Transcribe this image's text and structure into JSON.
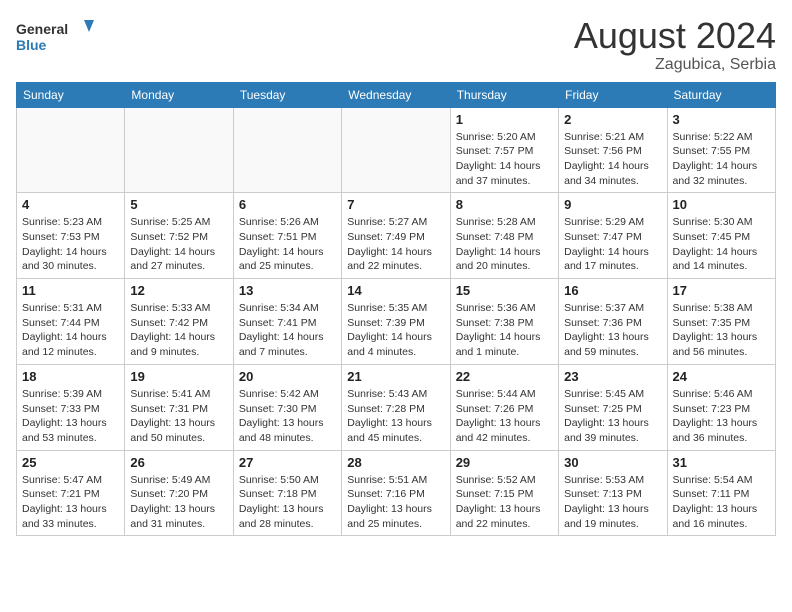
{
  "header": {
    "logo_line1": "General",
    "logo_line2": "Blue",
    "month_year": "August 2024",
    "location": "Zagubica, Serbia"
  },
  "days_of_week": [
    "Sunday",
    "Monday",
    "Tuesday",
    "Wednesday",
    "Thursday",
    "Friday",
    "Saturday"
  ],
  "weeks": [
    [
      {
        "day": "",
        "info": ""
      },
      {
        "day": "",
        "info": ""
      },
      {
        "day": "",
        "info": ""
      },
      {
        "day": "",
        "info": ""
      },
      {
        "day": "1",
        "info": "Sunrise: 5:20 AM\nSunset: 7:57 PM\nDaylight: 14 hours\nand 37 minutes."
      },
      {
        "day": "2",
        "info": "Sunrise: 5:21 AM\nSunset: 7:56 PM\nDaylight: 14 hours\nand 34 minutes."
      },
      {
        "day": "3",
        "info": "Sunrise: 5:22 AM\nSunset: 7:55 PM\nDaylight: 14 hours\nand 32 minutes."
      }
    ],
    [
      {
        "day": "4",
        "info": "Sunrise: 5:23 AM\nSunset: 7:53 PM\nDaylight: 14 hours\nand 30 minutes."
      },
      {
        "day": "5",
        "info": "Sunrise: 5:25 AM\nSunset: 7:52 PM\nDaylight: 14 hours\nand 27 minutes."
      },
      {
        "day": "6",
        "info": "Sunrise: 5:26 AM\nSunset: 7:51 PM\nDaylight: 14 hours\nand 25 minutes."
      },
      {
        "day": "7",
        "info": "Sunrise: 5:27 AM\nSunset: 7:49 PM\nDaylight: 14 hours\nand 22 minutes."
      },
      {
        "day": "8",
        "info": "Sunrise: 5:28 AM\nSunset: 7:48 PM\nDaylight: 14 hours\nand 20 minutes."
      },
      {
        "day": "9",
        "info": "Sunrise: 5:29 AM\nSunset: 7:47 PM\nDaylight: 14 hours\nand 17 minutes."
      },
      {
        "day": "10",
        "info": "Sunrise: 5:30 AM\nSunset: 7:45 PM\nDaylight: 14 hours\nand 14 minutes."
      }
    ],
    [
      {
        "day": "11",
        "info": "Sunrise: 5:31 AM\nSunset: 7:44 PM\nDaylight: 14 hours\nand 12 minutes."
      },
      {
        "day": "12",
        "info": "Sunrise: 5:33 AM\nSunset: 7:42 PM\nDaylight: 14 hours\nand 9 minutes."
      },
      {
        "day": "13",
        "info": "Sunrise: 5:34 AM\nSunset: 7:41 PM\nDaylight: 14 hours\nand 7 minutes."
      },
      {
        "day": "14",
        "info": "Sunrise: 5:35 AM\nSunset: 7:39 PM\nDaylight: 14 hours\nand 4 minutes."
      },
      {
        "day": "15",
        "info": "Sunrise: 5:36 AM\nSunset: 7:38 PM\nDaylight: 14 hours\nand 1 minute."
      },
      {
        "day": "16",
        "info": "Sunrise: 5:37 AM\nSunset: 7:36 PM\nDaylight: 13 hours\nand 59 minutes."
      },
      {
        "day": "17",
        "info": "Sunrise: 5:38 AM\nSunset: 7:35 PM\nDaylight: 13 hours\nand 56 minutes."
      }
    ],
    [
      {
        "day": "18",
        "info": "Sunrise: 5:39 AM\nSunset: 7:33 PM\nDaylight: 13 hours\nand 53 minutes."
      },
      {
        "day": "19",
        "info": "Sunrise: 5:41 AM\nSunset: 7:31 PM\nDaylight: 13 hours\nand 50 minutes."
      },
      {
        "day": "20",
        "info": "Sunrise: 5:42 AM\nSunset: 7:30 PM\nDaylight: 13 hours\nand 48 minutes."
      },
      {
        "day": "21",
        "info": "Sunrise: 5:43 AM\nSunset: 7:28 PM\nDaylight: 13 hours\nand 45 minutes."
      },
      {
        "day": "22",
        "info": "Sunrise: 5:44 AM\nSunset: 7:26 PM\nDaylight: 13 hours\nand 42 minutes."
      },
      {
        "day": "23",
        "info": "Sunrise: 5:45 AM\nSunset: 7:25 PM\nDaylight: 13 hours\nand 39 minutes."
      },
      {
        "day": "24",
        "info": "Sunrise: 5:46 AM\nSunset: 7:23 PM\nDaylight: 13 hours\nand 36 minutes."
      }
    ],
    [
      {
        "day": "25",
        "info": "Sunrise: 5:47 AM\nSunset: 7:21 PM\nDaylight: 13 hours\nand 33 minutes."
      },
      {
        "day": "26",
        "info": "Sunrise: 5:49 AM\nSunset: 7:20 PM\nDaylight: 13 hours\nand 31 minutes."
      },
      {
        "day": "27",
        "info": "Sunrise: 5:50 AM\nSunset: 7:18 PM\nDaylight: 13 hours\nand 28 minutes."
      },
      {
        "day": "28",
        "info": "Sunrise: 5:51 AM\nSunset: 7:16 PM\nDaylight: 13 hours\nand 25 minutes."
      },
      {
        "day": "29",
        "info": "Sunrise: 5:52 AM\nSunset: 7:15 PM\nDaylight: 13 hours\nand 22 minutes."
      },
      {
        "day": "30",
        "info": "Sunrise: 5:53 AM\nSunset: 7:13 PM\nDaylight: 13 hours\nand 19 minutes."
      },
      {
        "day": "31",
        "info": "Sunrise: 5:54 AM\nSunset: 7:11 PM\nDaylight: 13 hours\nand 16 minutes."
      }
    ]
  ]
}
